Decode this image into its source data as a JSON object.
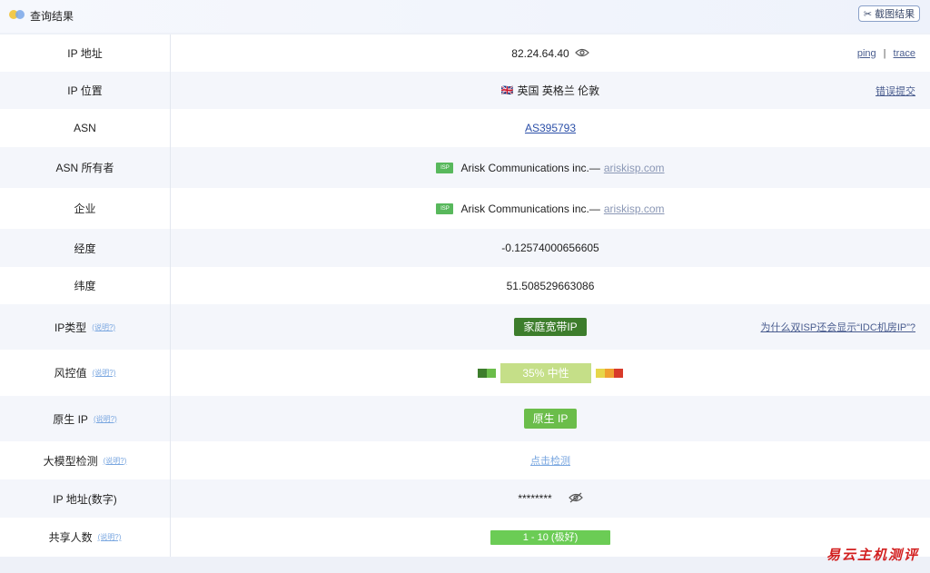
{
  "header": {
    "title": "查询结果",
    "screenshot_button": "截图结果"
  },
  "rows": {
    "ip": {
      "label": "IP 地址",
      "value": "82.24.64.40",
      "ping": "ping",
      "sep": "|",
      "trace": "trace"
    },
    "location": {
      "label": "IP 位置",
      "flag": "🇬🇧",
      "value": "英国 英格兰 伦敦",
      "report": "错误提交"
    },
    "asn": {
      "label": "ASN",
      "value": "AS395793"
    },
    "asn_owner": {
      "label": "ASN 所有者",
      "tag": "ISP",
      "value": "Arisk Communications inc.—",
      "domain": "ariskisp.com"
    },
    "company": {
      "label": "企业",
      "tag": "ISP",
      "value": "Arisk Communications inc.—",
      "domain": "ariskisp.com"
    },
    "longitude": {
      "label": "经度",
      "value": "-0.12574000656605"
    },
    "latitude": {
      "label": "纬度",
      "value": "51.508529663086"
    },
    "ip_type": {
      "label": "IP类型",
      "help": "(说明?)",
      "value": "家庭宽带IP",
      "question": "为什么双ISP还会显示“IDC机房IP”?"
    },
    "risk": {
      "label": "风控值",
      "help": "(说明?)",
      "value": "35%  中性",
      "level": 0.35
    },
    "native": {
      "label": "原生 IP",
      "help": "(说明?)",
      "value": "原生 IP"
    },
    "llm": {
      "label": "大模型检测",
      "help": "(说明?)",
      "value": "点击检测"
    },
    "ip_num": {
      "label": "IP 地址(数字)",
      "value": "********"
    },
    "shared": {
      "label": "共享人数",
      "help": "(说明?)",
      "value": "1 - 10 (极好)"
    }
  },
  "watermark": "易云主机测评",
  "colors": {
    "dark_green": "#3d7d2c",
    "green": "#6bbd4a",
    "risk_neutral": "#c5df88",
    "link": "#2b4fa8"
  }
}
